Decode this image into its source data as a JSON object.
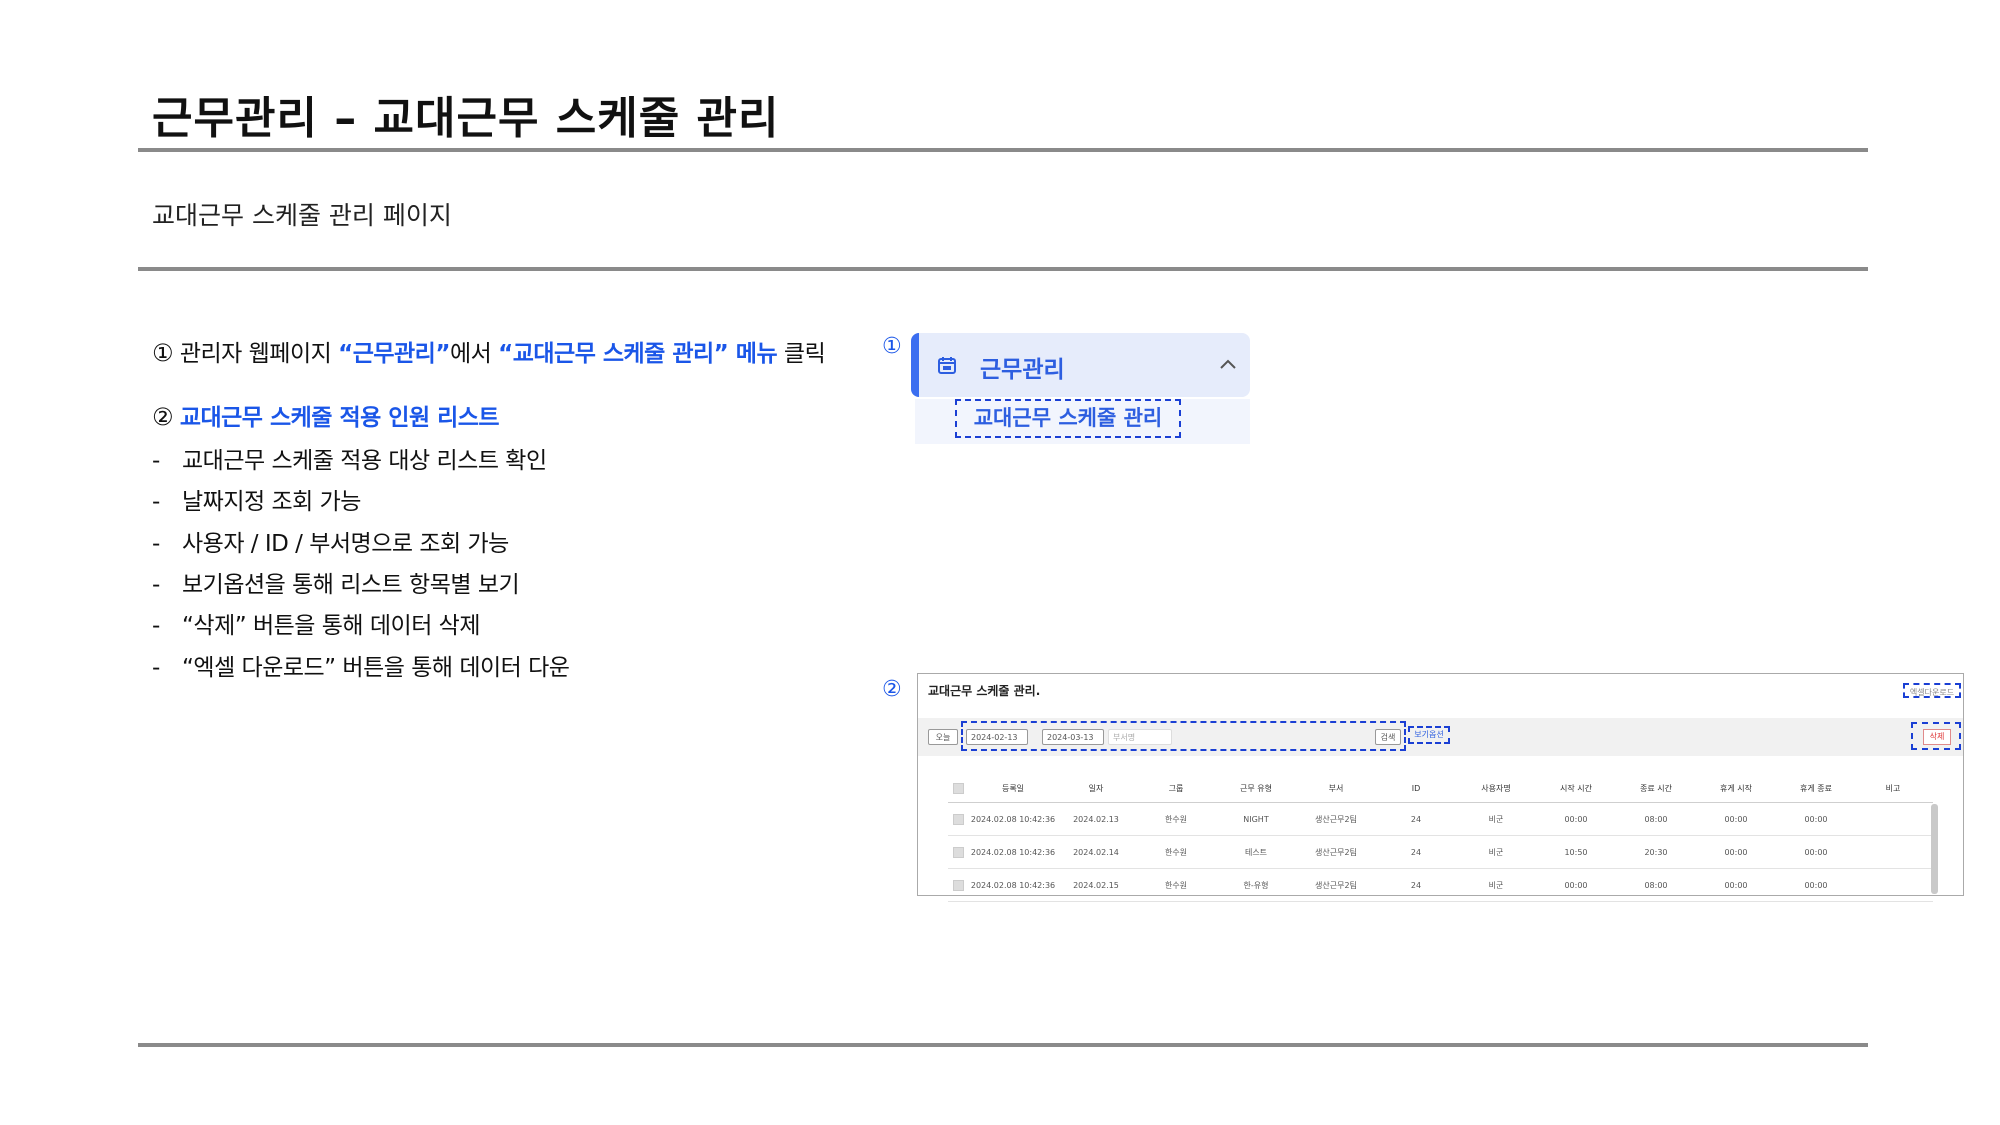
{
  "title": "근무관리 – 교대근무 스케줄 관리",
  "subtitle": "교대근무 스케줄 관리 페이지",
  "step1": {
    "num": "①",
    "pre": "관리자 웹페이지 ",
    "q1": "“근무관리”",
    "mid": "에서 ",
    "q2": "“교대근무 스케줄 관리” 메뉴",
    "post": " 클릭"
  },
  "step2": {
    "num": "②",
    "heading": "교대근무 스케줄 적용 인원 리스트",
    "bullets": [
      "교대근무 스케줄 적용 대상 리스트 확인",
      "날짜지정 조회 가능",
      "사용자 / ID / 부서명으로 조회 가능",
      "보기옵션을 통해 리스트 항목별 보기",
      "“삭제” 버튼을 통해 데이터 삭제",
      "“엑셀 다운로드” 버튼을 통해 데이터 다운"
    ],
    "dash": "-"
  },
  "panel1": {
    "num": "①",
    "menu": "근무관리",
    "submenu": "교대근무 스케줄 관리",
    "icon": "calendar-icon",
    "chevron": "^"
  },
  "panel2": {
    "num": "②",
    "title": "교대근무 스케줄 관리.",
    "excel": "엑셀다운로드",
    "today": "오늘",
    "start_date": "2024-02-13",
    "end_date": "2024-03-13",
    "dept_placeholder": "부서명",
    "search": "검색",
    "view_option": "보기옵션",
    "delete": "삭제",
    "columns": [
      "등록일",
      "일자",
      "그룹",
      "근무 유형",
      "부서",
      "ID",
      "사용자명",
      "시작 시간",
      "종료 시간",
      "휴게 시작",
      "휴게 종료",
      "비고"
    ],
    "rows": [
      [
        "2024.02.08 10:42:36",
        "2024.02.13",
        "한수원",
        "NIGHT",
        "생산근무2팀",
        "24",
        "비군",
        "00:00",
        "08:00",
        "00:00",
        "00:00",
        ""
      ],
      [
        "2024.02.08 10:42:36",
        "2024.02.14",
        "한수원",
        "테스트",
        "생산근무2팀",
        "24",
        "비군",
        "10:50",
        "20:30",
        "00:00",
        "00:00",
        ""
      ],
      [
        "2024.02.08 10:42:36",
        "2024.02.15",
        "한수원",
        "한-유형",
        "생산근무2팀",
        "24",
        "비군",
        "00:00",
        "08:00",
        "00:00",
        "00:00",
        ""
      ]
    ]
  }
}
